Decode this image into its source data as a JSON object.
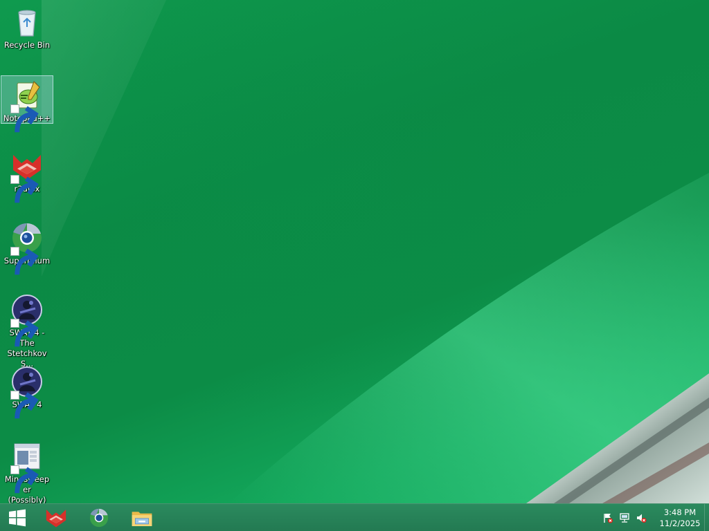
{
  "desktop": {
    "icons": [
      {
        "label": "Recycle Bin",
        "icon": "recycle-bin-icon",
        "shortcut": false,
        "selected": false
      },
      {
        "label": "Notepad++",
        "icon": "notepad-plus-plus-icon",
        "shortcut": true,
        "selected": true
      },
      {
        "label": "r3dfox",
        "icon": "r3dfox-icon",
        "shortcut": true,
        "selected": false
      },
      {
        "label": "Supermium",
        "icon": "supermium-icon",
        "shortcut": true,
        "selected": false
      },
      {
        "label": "SWAT 4 - The Stetchkov S...",
        "icon": "swat4-icon",
        "shortcut": true,
        "selected": false
      },
      {
        "label": "SWAT 4",
        "icon": "swat4-icon",
        "shortcut": true,
        "selected": false
      },
      {
        "label": "Minesweeper (Possibly)",
        "icon": "minesweeper-icon",
        "shortcut": true,
        "selected": false
      }
    ]
  },
  "taskbar": {
    "start": {
      "icon": "windows-logo-icon"
    },
    "pinned": [
      {
        "icon": "r3dfox-icon"
      },
      {
        "icon": "supermium-icon"
      },
      {
        "icon": "file-explorer-icon"
      }
    ],
    "tray": {
      "icons": [
        "action-center-flag-icon",
        "network-icon",
        "volume-muted-icon"
      ],
      "time": "3:48 PM",
      "date": "11/2/2025"
    }
  },
  "colors": {
    "wallpaper": "#0f9a4e",
    "taskbar": "#237a52",
    "label_text": "#ffffff"
  }
}
